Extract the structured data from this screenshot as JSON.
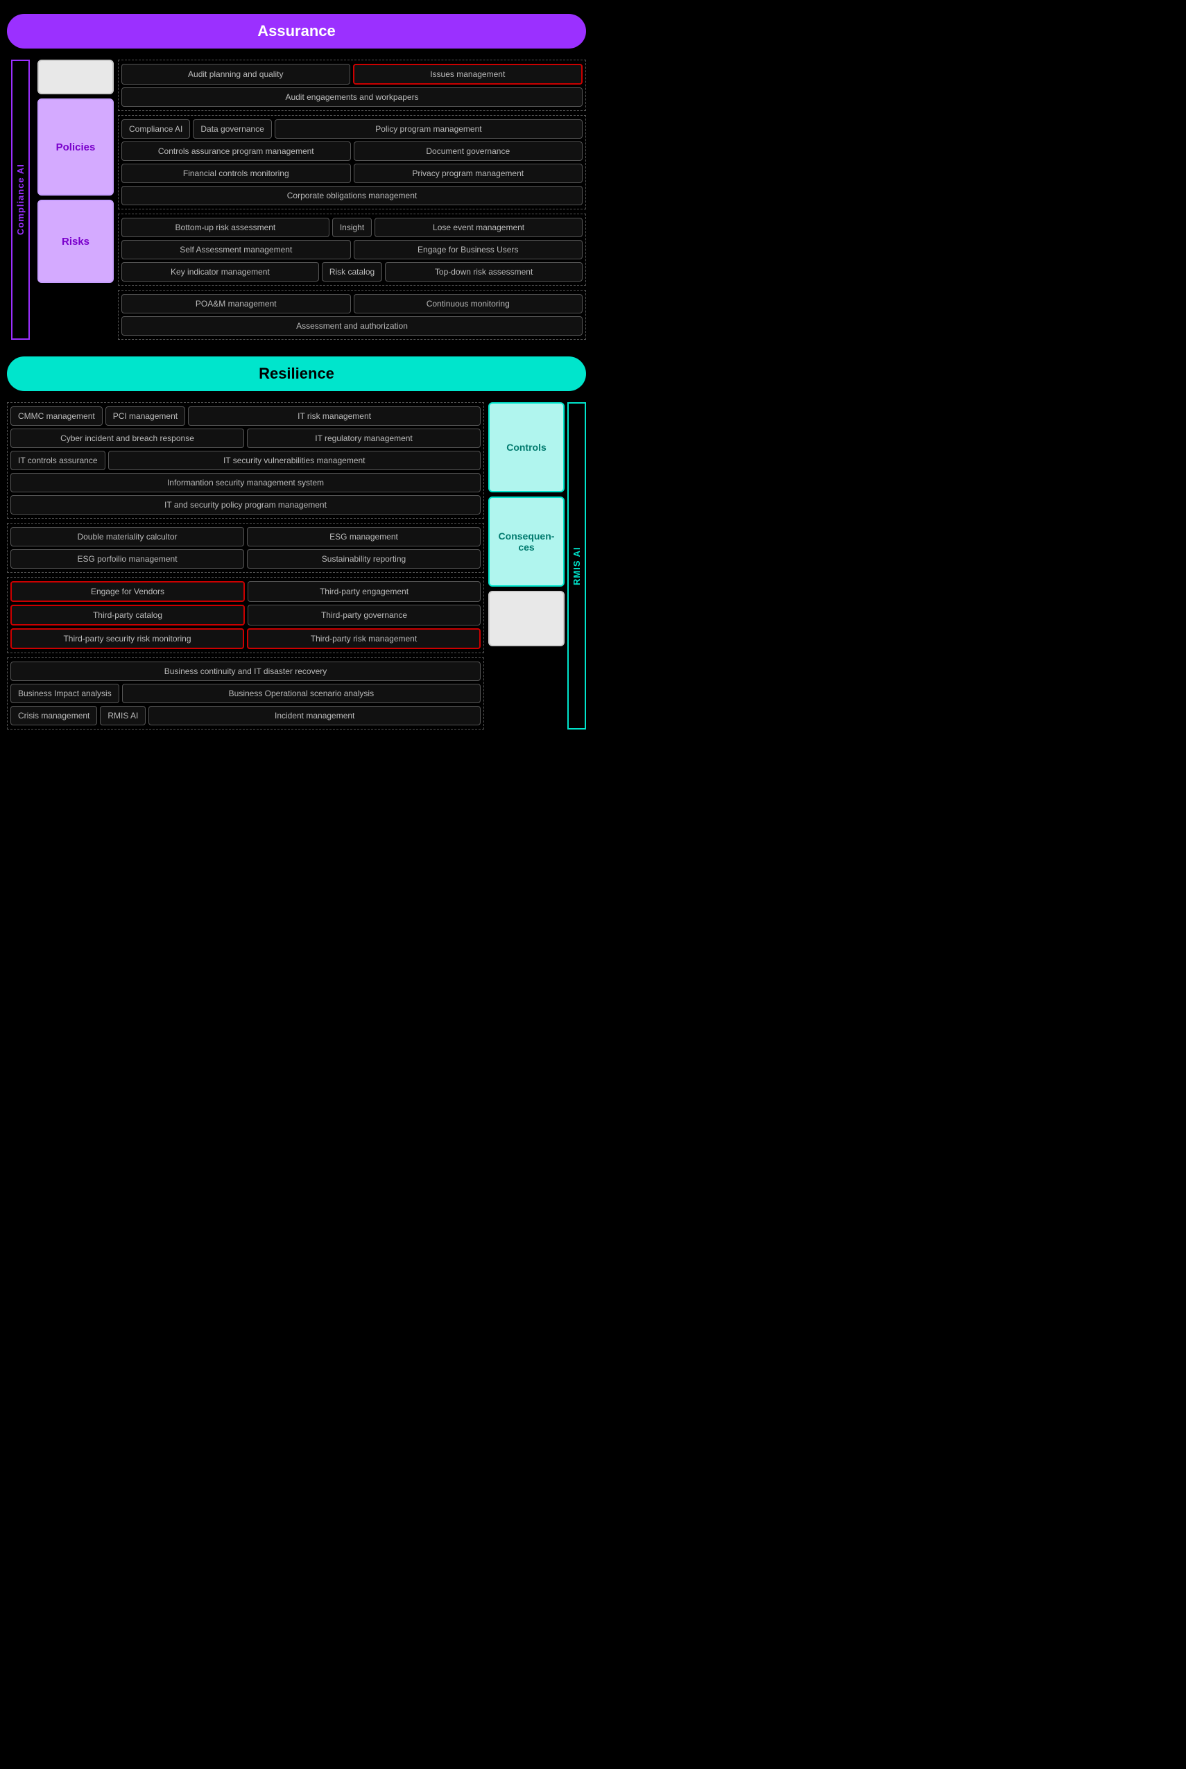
{
  "banners": {
    "assurance": "Assurance",
    "resilience": "Resilience"
  },
  "assurance": {
    "left_label": "Compliance AI",
    "side_categories": [
      {
        "id": "empty",
        "label": "",
        "type": "small"
      },
      {
        "id": "policies",
        "label": "Policies",
        "type": "policies"
      },
      {
        "id": "risks",
        "label": "Risks",
        "type": "risks"
      }
    ],
    "groups": [
      {
        "id": "audit-group",
        "rows": [
          [
            {
              "text": "Audit planning and quality",
              "flex": true,
              "redBorder": false
            },
            {
              "text": "Issues management",
              "flex": true,
              "redBorder": true
            }
          ],
          [
            {
              "text": "Audit engagements and workpapers",
              "flex": true,
              "redBorder": false
            }
          ]
        ]
      },
      {
        "id": "compliance-group",
        "rows": [
          [
            {
              "text": "Compliance AI",
              "flex": false,
              "redBorder": false
            },
            {
              "text": "Data governance",
              "flex": false,
              "redBorder": false
            },
            {
              "text": "Policy program management",
              "flex": true,
              "redBorder": false
            }
          ],
          [
            {
              "text": "Controls assurance program management",
              "flex": true,
              "redBorder": false
            },
            {
              "text": "Document governance",
              "flex": true,
              "redBorder": false
            }
          ],
          [
            {
              "text": "Financial controls monitoring",
              "flex": true,
              "redBorder": false
            },
            {
              "text": "Privacy program management",
              "flex": true,
              "redBorder": false
            }
          ],
          [
            {
              "text": "Corporate obligations management",
              "flex": true,
              "redBorder": false
            }
          ]
        ]
      },
      {
        "id": "risk-group",
        "rows": [
          [
            {
              "text": "Bottom-up risk assessment",
              "flex": true,
              "redBorder": false
            },
            {
              "text": "Insight",
              "flex": false,
              "redBorder": false
            },
            {
              "text": "Lose event management",
              "flex": true,
              "redBorder": false
            }
          ],
          [
            {
              "text": "Self Assessment management",
              "flex": true,
              "redBorder": false
            },
            {
              "text": "Engage for Business Users",
              "flex": true,
              "redBorder": false
            }
          ],
          [
            {
              "text": "Key indicator management",
              "flex": true,
              "redBorder": false
            },
            {
              "text": "Risk catalog",
              "flex": false,
              "redBorder": false
            },
            {
              "text": "Top-down risk assessment",
              "flex": true,
              "redBorder": false
            }
          ]
        ]
      },
      {
        "id": "poam-group",
        "rows": [
          [
            {
              "text": "POA&M management",
              "flex": true,
              "redBorder": false
            },
            {
              "text": "Continuous monitoring",
              "flex": true,
              "redBorder": false
            }
          ],
          [
            {
              "text": "Assessment and authorization",
              "flex": true,
              "redBorder": false
            }
          ]
        ]
      }
    ]
  },
  "resilience": {
    "left_label": "RMIS AI",
    "groups": [
      {
        "id": "it-group",
        "rows": [
          [
            {
              "text": "CMMC management",
              "flex": false,
              "redBorder": false
            },
            {
              "text": "PCI management",
              "flex": false,
              "redBorder": false
            },
            {
              "text": "IT risk management",
              "flex": true,
              "redBorder": false
            }
          ],
          [
            {
              "text": "Cyber incident and breach response",
              "flex": true,
              "redBorder": false
            },
            {
              "text": "IT regulatory management",
              "flex": true,
              "redBorder": false
            }
          ],
          [
            {
              "text": "IT controls assurance",
              "flex": false,
              "redBorder": false
            },
            {
              "text": "IT security vulnerabilities management",
              "flex": true,
              "redBorder": false
            }
          ],
          [
            {
              "text": "Informantion security management system",
              "flex": true,
              "redBorder": false
            }
          ],
          [
            {
              "text": "IT and security policy program management",
              "flex": true,
              "redBorder": false
            }
          ]
        ]
      },
      {
        "id": "esg-group",
        "rows": [
          [
            {
              "text": "Double  materiality calcultor",
              "flex": true,
              "redBorder": false
            },
            {
              "text": "ESG management",
              "flex": true,
              "redBorder": false
            }
          ],
          [
            {
              "text": "ESG porfoilio management",
              "flex": true,
              "redBorder": false
            },
            {
              "text": "Sustainability reporting",
              "flex": true,
              "redBorder": false
            }
          ]
        ]
      },
      {
        "id": "thirdparty-group",
        "rows": [
          [
            {
              "text": "Engage for Vendors",
              "flex": true,
              "redBorder": true
            },
            {
              "text": "Third-party engagement",
              "flex": true,
              "redBorder": false
            }
          ],
          [
            {
              "text": "Third-party catalog",
              "flex": true,
              "redBorder": true
            },
            {
              "text": "Third-party governance",
              "flex": true,
              "redBorder": false
            }
          ],
          [
            {
              "text": "Third-party security risk monitoring",
              "flex": true,
              "redBorder": true
            },
            {
              "text": "Third-party risk management",
              "flex": true,
              "redBorder": true
            }
          ]
        ]
      },
      {
        "id": "continuity-group",
        "rows": [
          [
            {
              "text": "Business continuity and IT disaster recovery",
              "flex": true,
              "redBorder": false
            }
          ],
          [
            {
              "text": "Business Impact analysis",
              "flex": false,
              "redBorder": false
            },
            {
              "text": "Business Operational scenario analysis",
              "flex": true,
              "redBorder": false
            }
          ],
          [
            {
              "text": "Crisis management",
              "flex": false,
              "redBorder": false
            },
            {
              "text": "RMIS AI",
              "flex": false,
              "redBorder": false
            },
            {
              "text": "Incident management",
              "flex": true,
              "redBorder": false
            }
          ]
        ]
      }
    ],
    "right_boxes": [
      {
        "id": "controls",
        "label": "Controls",
        "type": "cyan"
      },
      {
        "id": "consequences",
        "label": "Consequen-ces",
        "type": "cyan"
      },
      {
        "id": "empty",
        "label": "",
        "type": "empty"
      }
    ]
  }
}
